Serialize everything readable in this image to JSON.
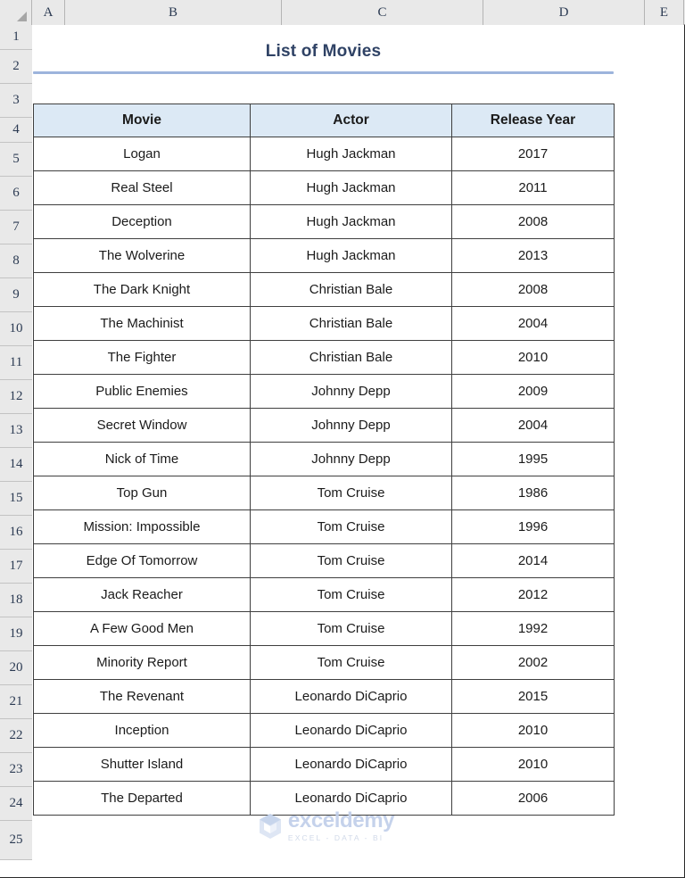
{
  "spreadsheet": {
    "column_headers": [
      "A",
      "B",
      "C",
      "D",
      "E"
    ],
    "row_headers": [
      "1",
      "2",
      "3",
      "4",
      "5",
      "6",
      "7",
      "8",
      "9",
      "10",
      "11",
      "12",
      "13",
      "14",
      "15",
      "16",
      "17",
      "18",
      "19",
      "20",
      "21",
      "22",
      "23",
      "24",
      "25"
    ],
    "select_all_icon": "select-all-triangle-icon"
  },
  "title": {
    "text": "List of Movies",
    "color": "#2f4265",
    "rule_color": "#9db4dc"
  },
  "table": {
    "header_fill": "#dce9f5",
    "border_color": "#3f3f3f",
    "columns": [
      "Movie",
      "Actor",
      "Release Year"
    ],
    "rows": [
      [
        "Logan",
        "Hugh Jackman",
        "2017"
      ],
      [
        "Real Steel",
        "Hugh Jackman",
        "2011"
      ],
      [
        "Deception",
        "Hugh Jackman",
        "2008"
      ],
      [
        "The Wolverine",
        "Hugh Jackman",
        "2013"
      ],
      [
        "The Dark Knight",
        "Christian Bale",
        "2008"
      ],
      [
        "The Machinist",
        "Christian Bale",
        "2004"
      ],
      [
        "The Fighter",
        "Christian Bale",
        "2010"
      ],
      [
        "Public Enemies",
        "Johnny Depp",
        "2009"
      ],
      [
        "Secret Window",
        "Johnny Depp",
        "2004"
      ],
      [
        "Nick of Time",
        "Johnny Depp",
        "1995"
      ],
      [
        "Top Gun",
        "Tom Cruise",
        "1986"
      ],
      [
        "Mission: Impossible",
        "Tom Cruise",
        "1996"
      ],
      [
        "Edge Of Tomorrow",
        "Tom Cruise",
        "2014"
      ],
      [
        "Jack Reacher",
        "Tom Cruise",
        "2012"
      ],
      [
        "A Few Good Men",
        "Tom Cruise",
        "1992"
      ],
      [
        "Minority Report",
        "Tom Cruise",
        "2002"
      ],
      [
        "The Revenant",
        "Leonardo DiCaprio",
        "2015"
      ],
      [
        "Inception",
        "Leonardo DiCaprio",
        "2010"
      ],
      [
        "Shutter Island",
        "Leonardo DiCaprio",
        "2010"
      ],
      [
        "The Departed",
        "Leonardo DiCaprio",
        "2006"
      ]
    ]
  },
  "watermark": {
    "name": "exceldemy",
    "tagline": "EXCEL - DATA - BI",
    "logo_icon": "exceldemy-cube-logo-icon",
    "color": "#c2d0ea"
  }
}
